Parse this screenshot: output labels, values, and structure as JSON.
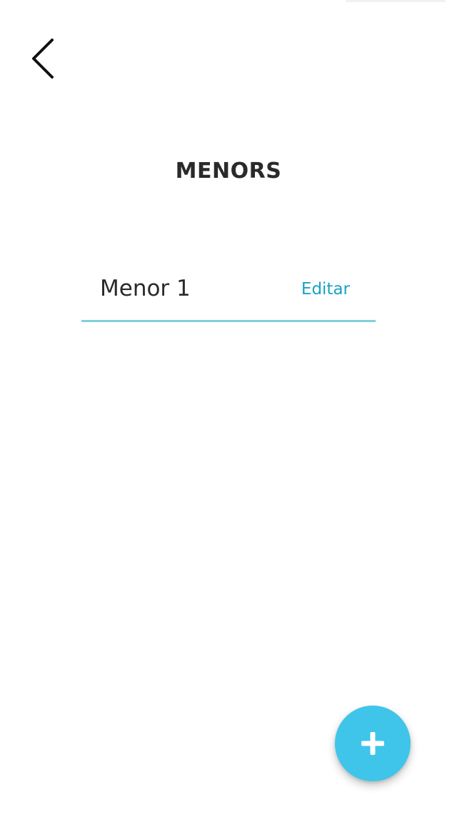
{
  "header": {
    "back_icon": "chevron-left-icon",
    "title": "MENORS"
  },
  "list": {
    "items": [
      {
        "label": "Menor 1",
        "action_label": "Editar"
      }
    ]
  },
  "fab": {
    "icon": "plus-icon"
  },
  "colors": {
    "accent": "#3fc5ea",
    "link": "#1aa2c4",
    "divider": "#7fd0de",
    "text": "#2a2a2a",
    "background": "#ffffff"
  }
}
